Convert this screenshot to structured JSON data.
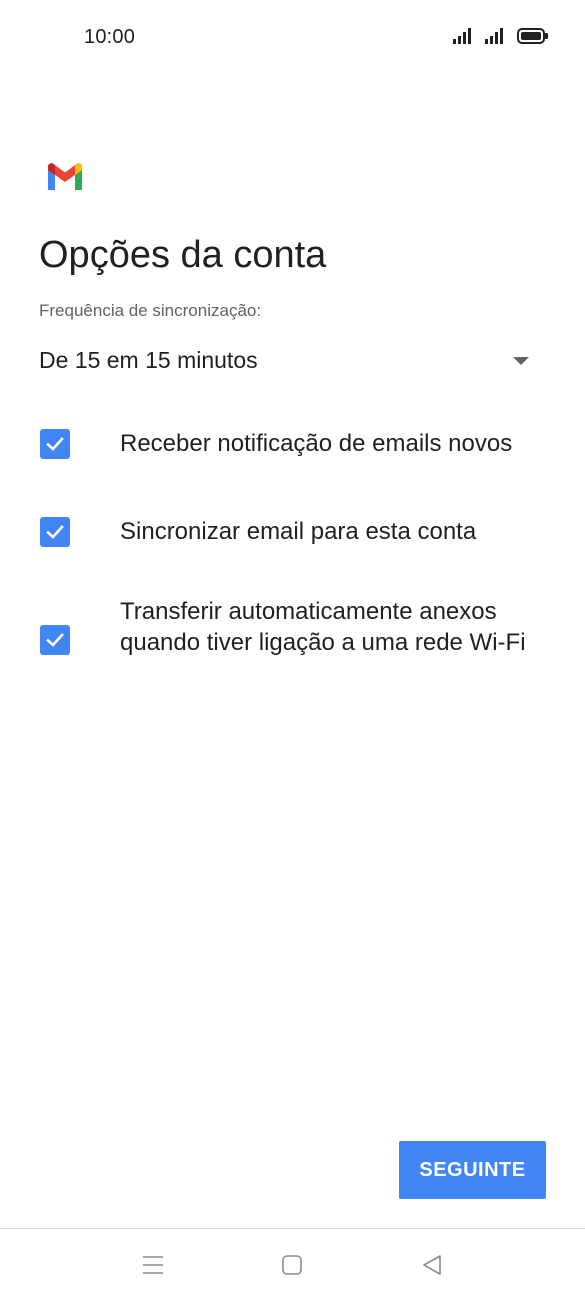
{
  "status_bar": {
    "time": "10:00",
    "icons": [
      "signal-icon",
      "signal-icon",
      "battery-icon"
    ]
  },
  "app": {
    "logo_icon": "gmail-icon"
  },
  "page": {
    "title": "Opções da conta"
  },
  "sync": {
    "label": "Frequência de sincronização:",
    "selected_value": "De 15 em 15 minutos"
  },
  "options": [
    {
      "label": "Receber notificação de emails novos",
      "checked": true
    },
    {
      "label": "Sincronizar email para esta conta",
      "checked": true
    },
    {
      "label": "Transferir automaticamente anexos quando tiver ligação a uma rede Wi-Fi",
      "checked": true
    }
  ],
  "actions": {
    "next_label": "SEGUINTE"
  },
  "nav_bar": {
    "buttons": [
      "menu-icon",
      "home-icon",
      "back-icon"
    ]
  },
  "colors": {
    "accent": "#4285f4",
    "text_primary": "#202124",
    "text_secondary": "#5f6368"
  }
}
